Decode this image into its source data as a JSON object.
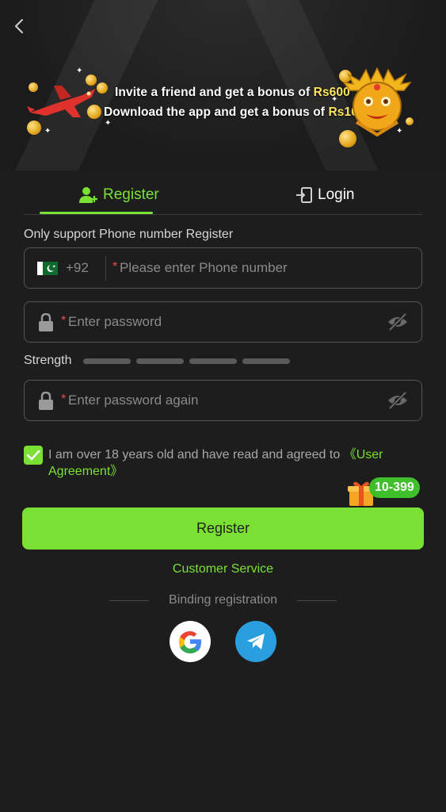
{
  "banner": {
    "line1_prefix": "Invite a friend and get a bonus of ",
    "line1_amount": "Rs600",
    "line2_prefix": "Download the app and get a bonus of ",
    "line2_amount": "Rs100"
  },
  "tabs": {
    "register": "Register",
    "login": "Login",
    "active": "register"
  },
  "form": {
    "hint": "Only support Phone number Register",
    "country_code": "+92",
    "phone_placeholder": "Please enter Phone number",
    "password_placeholder": "Enter password",
    "password_again_placeholder": "Enter password again",
    "required_mark": "*",
    "strength_label": "Strength",
    "strength_level": 0
  },
  "agreement": {
    "checked": true,
    "text": "I am over 18 years old and have read and agreed to ",
    "link_text": "《User Agreement》"
  },
  "gift_badge": "10-399",
  "register_button": "Register",
  "customer_service": "Customer Service",
  "binding": {
    "label": "Binding registration",
    "providers": [
      "google-icon",
      "telegram-icon"
    ]
  },
  "colors": {
    "accent": "#7be034",
    "background": "#1d1d1d",
    "required": "#e84b4b",
    "highlight": "#ffe55c"
  }
}
